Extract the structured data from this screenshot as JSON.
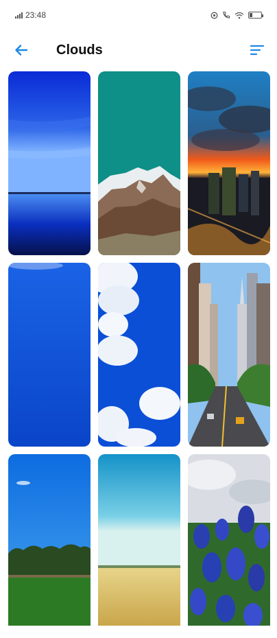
{
  "status": {
    "time": "23:48"
  },
  "app_bar": {
    "title": "Clouds",
    "back_icon": "arrow-left-icon",
    "sort_icon": "sort-icon",
    "accent": "#1e88e5"
  },
  "wallpapers": [
    {
      "subject": "blue-horizon-lake"
    },
    {
      "subject": "teal-sky-mountain"
    },
    {
      "subject": "sunset-city-clouds"
    },
    {
      "subject": "plain-blue-sky"
    },
    {
      "subject": "white-clouds-blue-sky"
    },
    {
      "subject": "city-street-skyscrapers"
    },
    {
      "subject": "blue-sky-green-field"
    },
    {
      "subject": "turquoise-sky-wheat-field"
    },
    {
      "subject": "blue-flowers-cloudy-sky"
    }
  ]
}
